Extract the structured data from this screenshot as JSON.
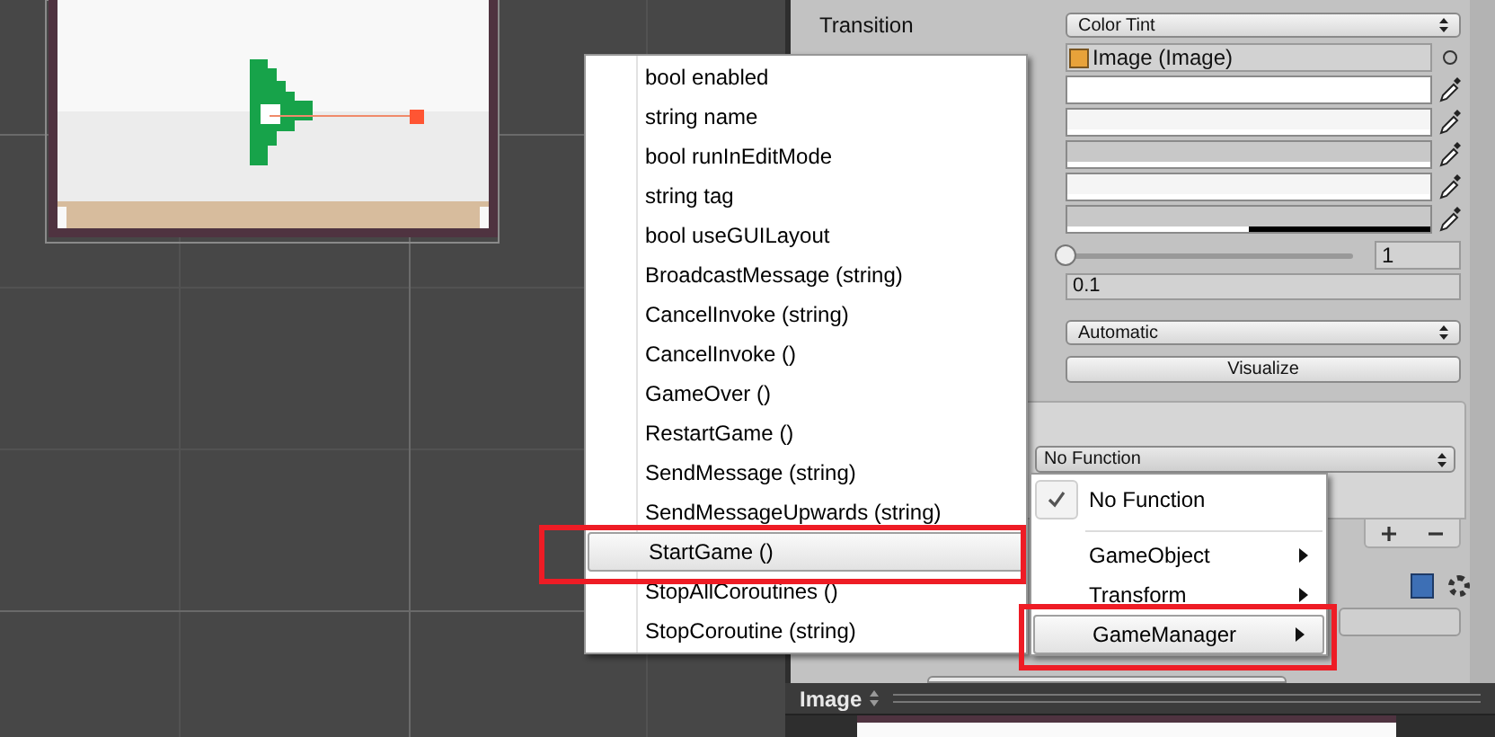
{
  "inspector": {
    "transition": {
      "label": "Transition",
      "value": "Color Tint"
    },
    "target_graphic": "Image (Image)",
    "color_swatches": [
      {
        "color": "#ffffff",
        "level": 1
      },
      {
        "color": "#f5f5f5",
        "level": 1
      },
      {
        "color": "#c8c8c8",
        "level": 1
      },
      {
        "color": "#f5f5f5",
        "level": 1
      },
      {
        "color": "#c8c8c8",
        "level": 0.5
      }
    ],
    "color_multiplier": {
      "level": 0,
      "value": "1"
    },
    "fade_duration": "0.1",
    "navigation": "Automatic",
    "visualize_button": "Visualize",
    "event_function": "No Function"
  },
  "method_menu": {
    "items": [
      {
        "label": "bool enabled",
        "selected": false
      },
      {
        "label": "string name",
        "selected": false
      },
      {
        "label": "bool runInEditMode",
        "selected": false
      },
      {
        "label": "string tag",
        "selected": false
      },
      {
        "label": "bool useGUILayout",
        "selected": false
      },
      {
        "label": "BroadcastMessage (string)",
        "selected": false
      },
      {
        "label": "CancelInvoke (string)",
        "selected": false
      },
      {
        "label": "CancelInvoke ()",
        "selected": false
      },
      {
        "label": "GameOver ()",
        "selected": false
      },
      {
        "label": "RestartGame ()",
        "selected": false
      },
      {
        "label": "SendMessage (string)",
        "selected": false
      },
      {
        "label": "SendMessageUpwards (string)",
        "selected": false
      },
      {
        "label": "StartGame ()",
        "selected": true
      },
      {
        "label": "StopAllCoroutines ()",
        "selected": false
      },
      {
        "label": "StopCoroutine (string)",
        "selected": false
      }
    ]
  },
  "function_menu": {
    "items": [
      {
        "label": "No Function",
        "kind": "option",
        "checked": true,
        "selected": false
      },
      {
        "label": "GameObject",
        "kind": "submenu",
        "checked": false,
        "selected": false
      },
      {
        "label": "Transform",
        "kind": "submenu",
        "checked": false,
        "selected": false
      },
      {
        "label": "GameManager",
        "kind": "submenu",
        "checked": false,
        "selected": true
      }
    ]
  },
  "preview": {
    "title": "Image"
  }
}
